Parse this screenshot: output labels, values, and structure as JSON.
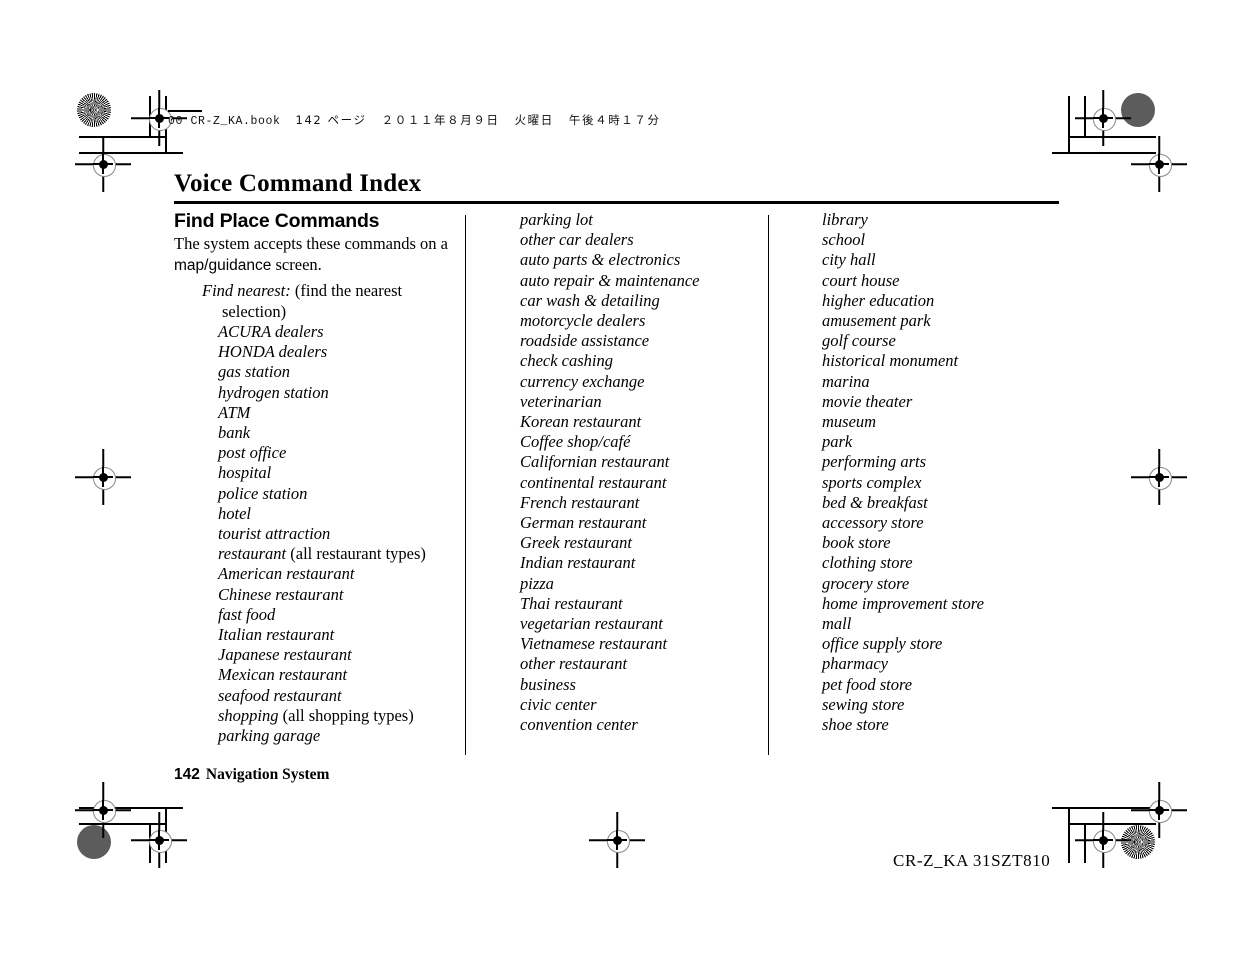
{
  "print_header": {
    "file": "00 CR-Z_KA.book",
    "page_label": "142 ページ",
    "date": "２０１１年８月９日",
    "weekday": "火曜日",
    "time": "午後４時１７分",
    "full": "00 CR-Z_KA.book　142 ページ　２０１１年８月９日　火曜日　午後４時１７分"
  },
  "page_title": "Voice Command Index",
  "section": {
    "heading": "Find Place Commands",
    "intro_part1": "The system accepts these commands on a ",
    "intro_ui": "map/guidance",
    "intro_part2": " screen."
  },
  "command_group": {
    "label": "Find nearest:",
    "note": "(find the nearest",
    "note_cont": "selection)"
  },
  "columns": {
    "col1": [
      "ACURA dealers",
      "HONDA dealers",
      "gas station",
      "hydrogen station",
      "ATM",
      "bank",
      "post office",
      "hospital",
      "police station",
      "hotel",
      "tourist attraction",
      "restaurant",
      "American restaurant",
      "Chinese restaurant",
      "fast food",
      "Italian restaurant",
      "Japanese restaurant",
      "Mexican restaurant",
      "seafood restaurant",
      "shopping",
      "parking garage"
    ],
    "col1_notes": {
      "restaurant": "(all restaurant types)",
      "shopping": "(all shopping types)"
    },
    "col2": [
      "parking lot",
      "other car dealers",
      "auto parts & electronics",
      "auto repair & maintenance",
      "car wash & detailing",
      "motorcycle dealers",
      "roadside assistance",
      "check cashing",
      "currency exchange",
      "veterinarian",
      "Korean restaurant",
      "Coffee shop/café",
      "Californian restaurant",
      "continental restaurant",
      "French restaurant",
      "German restaurant",
      "Greek restaurant",
      "Indian restaurant",
      "pizza",
      "Thai restaurant",
      "vegetarian restaurant",
      "Vietnamese restaurant",
      "other restaurant",
      "business",
      "civic center",
      "convention center"
    ],
    "col3": [
      "library",
      "school",
      "city hall",
      "court house",
      "higher education",
      "amusement park",
      "golf course",
      "historical monument",
      "marina",
      "movie theater",
      "museum",
      "park",
      "performing arts",
      "sports complex",
      "bed & breakfast",
      "accessory store",
      "book store",
      "clothing store",
      "grocery store",
      "home improvement store",
      "mall",
      "office supply store",
      "pharmacy",
      "pet food store",
      "sewing store",
      "shoe store"
    ]
  },
  "footer": {
    "page_number": "142",
    "section_name": "Navigation System",
    "doc_code": "CR-Z_KA  31SZT810"
  },
  "print_marks": {
    "top_left_circle": "halftone-circle",
    "top_right_circle": "solid-gray-circle",
    "bottom_left_circle": "solid-gray-circle",
    "bottom_right_circle": "halftone-circle",
    "gray_hex": "#5c5c5c"
  }
}
